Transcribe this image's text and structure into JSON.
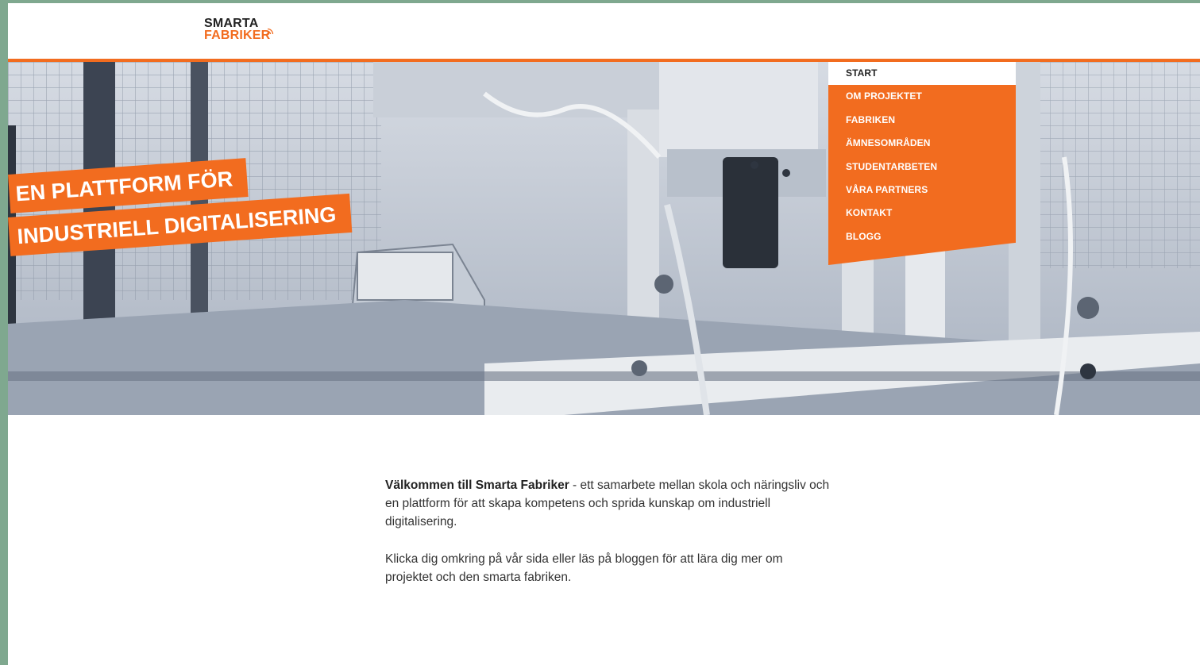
{
  "brand": {
    "line1": "SMARTA",
    "line2": "FABRIKER",
    "accent_color": "#f26c1f"
  },
  "hero": {
    "tagline_line1": "EN PLATTFORM FÖR",
    "tagline_line2": "INDUSTRIELL DIGITALISERING"
  },
  "nav": {
    "items": [
      {
        "label": "START",
        "active": true
      },
      {
        "label": "OM PROJEKTET"
      },
      {
        "label": "FABRIKEN"
      },
      {
        "label": "ÄMNESOMRÅDEN"
      },
      {
        "label": "STUDENTARBETEN"
      },
      {
        "label": "VÅRA PARTNERS"
      },
      {
        "label": "KONTAKT"
      },
      {
        "label": "BLOGG"
      }
    ]
  },
  "content": {
    "intro_bold": "Välkommen till Smarta Fabriker",
    "intro_rest": " - ett samarbete mellan skola och näringsliv och en plattform för att skapa kompetens och sprida kunskap om industriell digitalisering.",
    "paragraph2": "Klicka dig omkring på vår sida eller läs på bloggen för att lära dig mer om projektet och den smarta fabriken."
  }
}
